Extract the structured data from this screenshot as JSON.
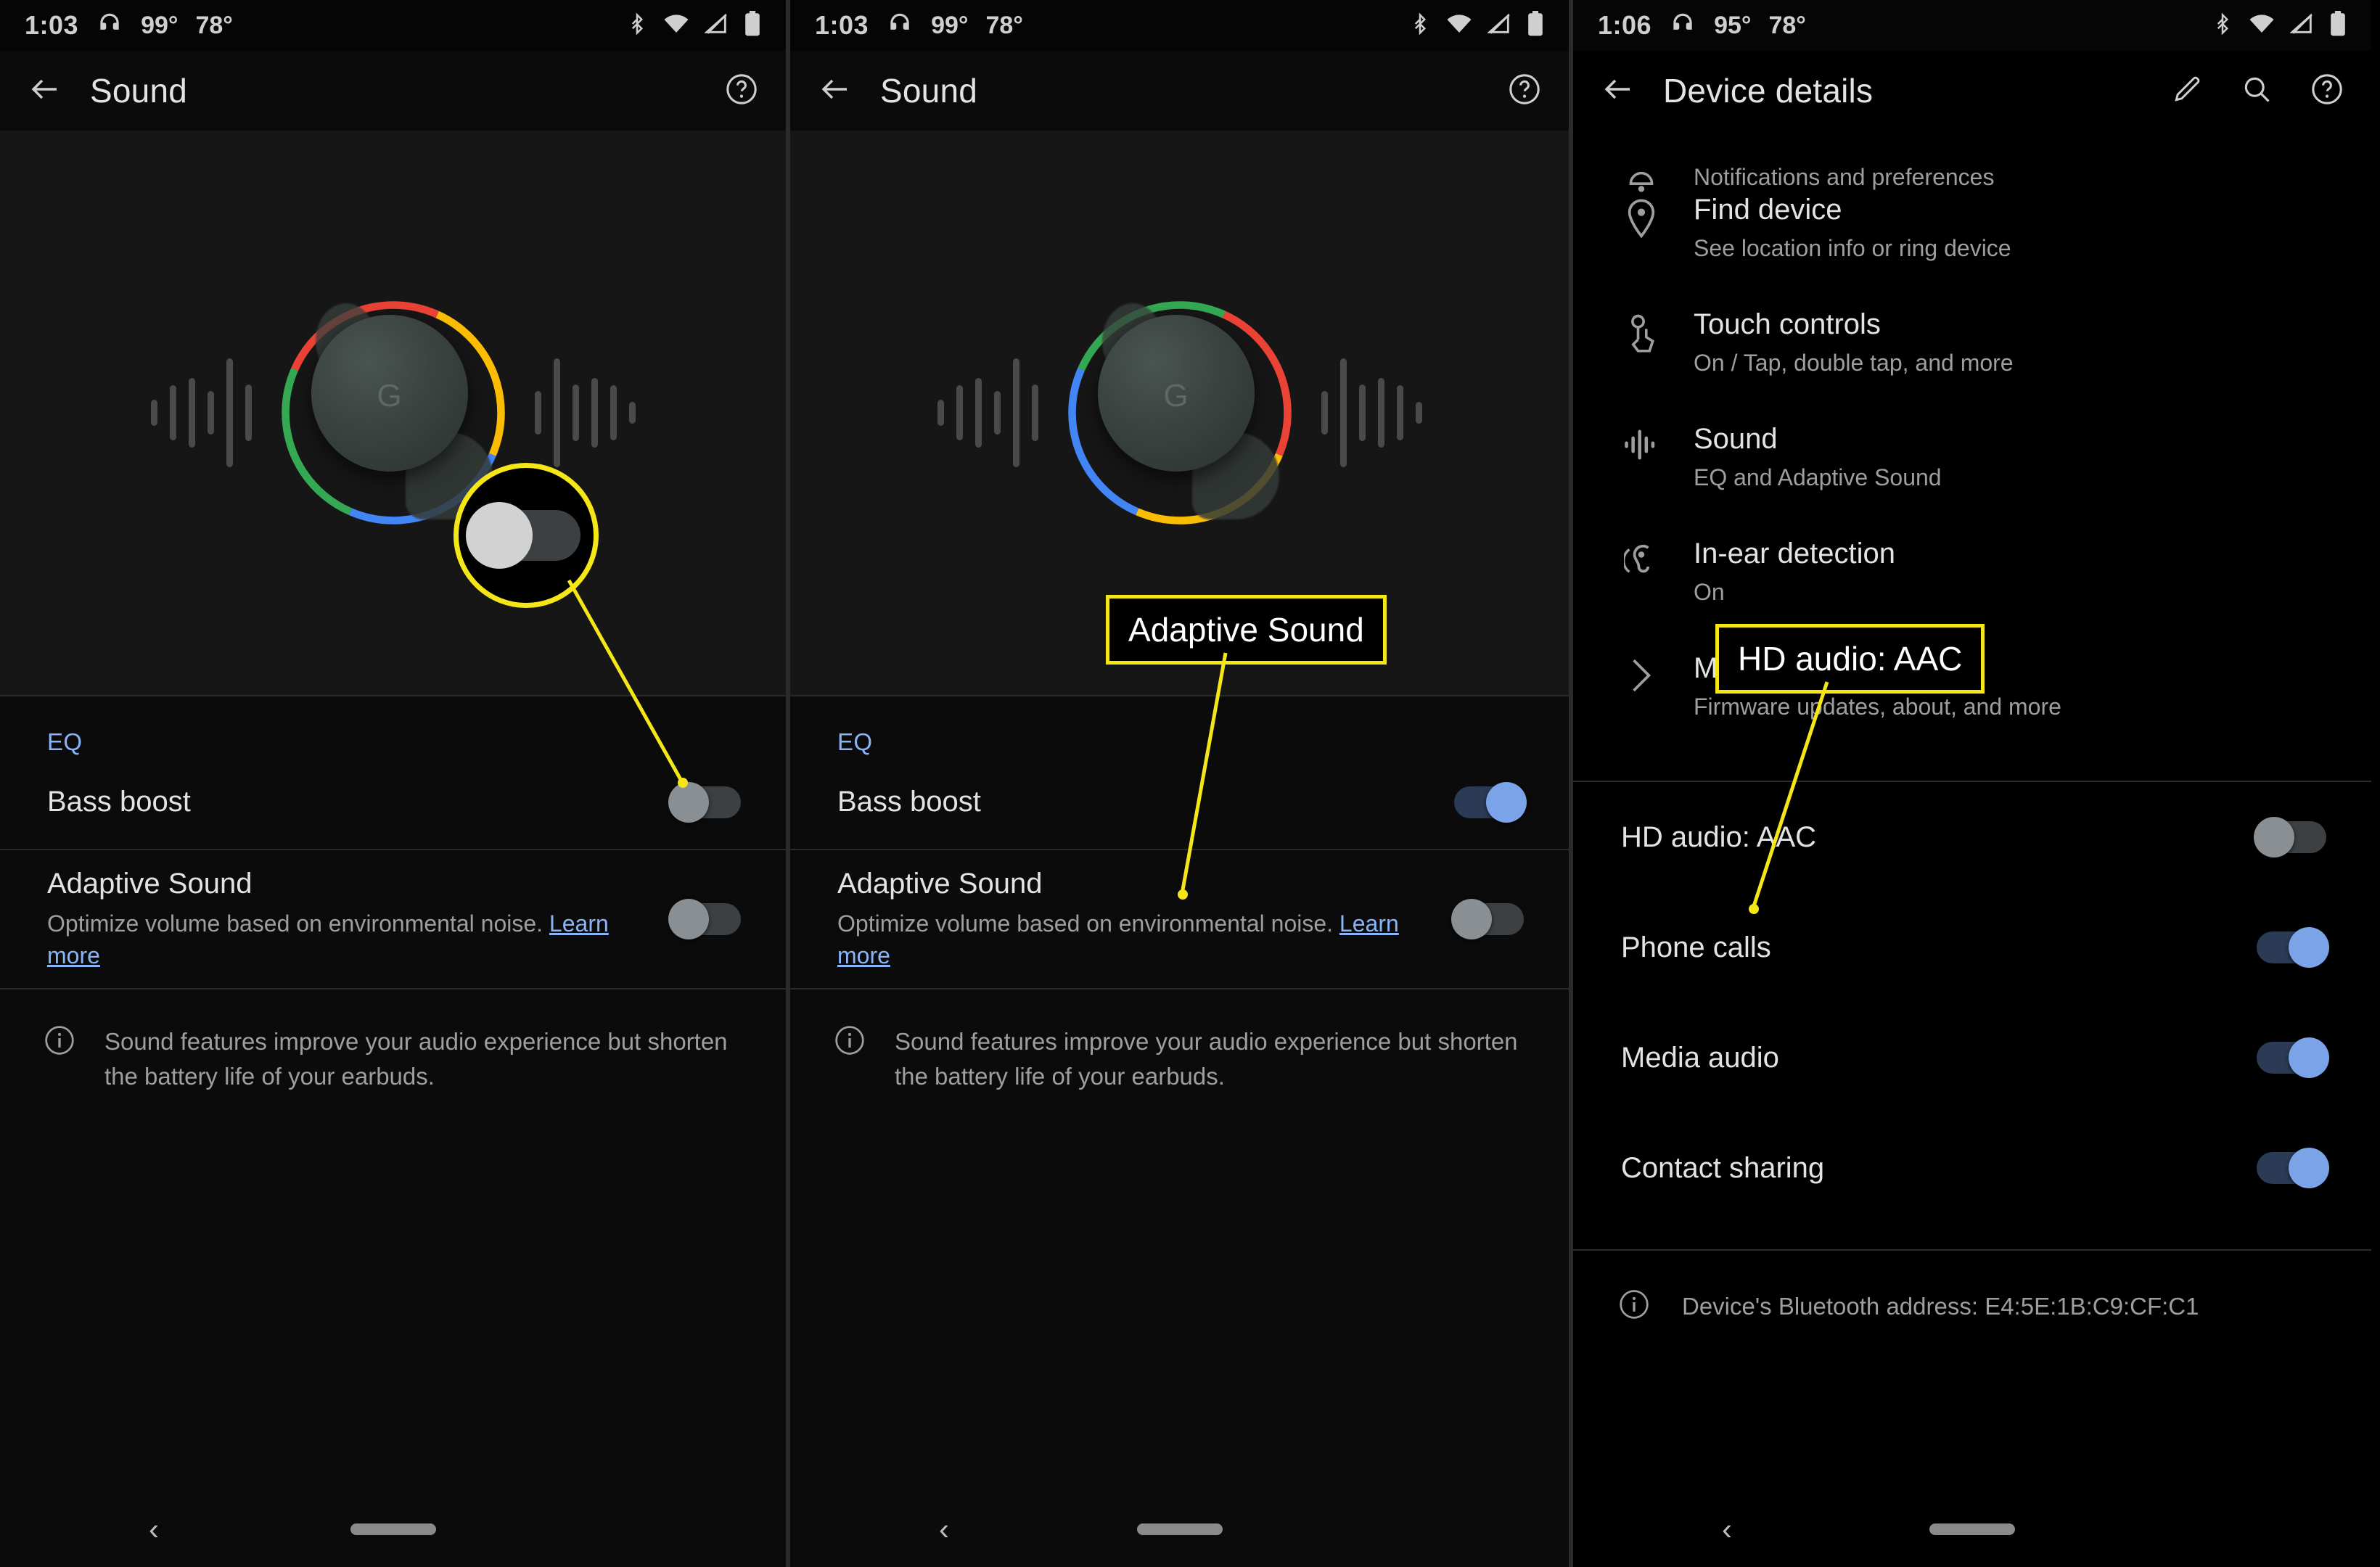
{
  "panels": [
    {
      "id": "sound-off",
      "status": {
        "time": "1:03",
        "headphone_icon": "headphone-icon",
        "temp1": "99°",
        "temp2": "78°",
        "icons": [
          "bluetooth-icon",
          "wifi-icon",
          "signal-off-icon",
          "battery-icon"
        ]
      },
      "appbar": {
        "back_icon": "back-arrow-icon",
        "title": "Sound",
        "help_icon": "help-circle-icon"
      },
      "eq_label": "EQ",
      "rows": [
        {
          "title": "Bass boost",
          "subtitle": "",
          "toggle": "off"
        },
        {
          "title": "Adaptive Sound",
          "subtitle": "Optimize volume based on environmental noise.",
          "link": "Learn more",
          "toggle": "off"
        }
      ],
      "note": {
        "icon": "info-circle-icon",
        "text": "Sound features improve your audio experience but shorten the battery life of your earbuds."
      },
      "nav": {
        "back": "nav-back-icon",
        "pill": "nav-home-pill"
      }
    },
    {
      "id": "sound-on",
      "status": {
        "time": "1:03",
        "headphone_icon": "headphone-icon",
        "temp1": "99°",
        "temp2": "78°",
        "icons": [
          "bluetooth-icon",
          "wifi-icon",
          "signal-off-icon",
          "battery-icon"
        ]
      },
      "appbar": {
        "back_icon": "back-arrow-icon",
        "title": "Sound",
        "help_icon": "help-circle-icon"
      },
      "eq_label": "EQ",
      "rows": [
        {
          "title": "Bass boost",
          "subtitle": "",
          "toggle": "on"
        },
        {
          "title": "Adaptive Sound",
          "subtitle": "Optimize volume based on environmental noise.",
          "link": "Learn more",
          "toggle": "off"
        }
      ],
      "note": {
        "icon": "info-circle-icon",
        "text": "Sound features improve your audio experience but shorten the battery life of your earbuds."
      },
      "nav": {
        "back": "nav-back-icon",
        "pill": "nav-home-pill"
      }
    },
    {
      "id": "device-details",
      "status": {
        "time": "1:06",
        "headphone_icon": "headphone-icon",
        "temp1": "95°",
        "temp2": "78°",
        "icons": [
          "bluetooth-icon",
          "wifi-icon",
          "signal-off-icon",
          "battery-icon"
        ]
      },
      "appbar": {
        "back_icon": "back-arrow-icon",
        "title": "Device details",
        "edit_icon": "pencil-icon",
        "search_icon": "search-icon",
        "help_icon": "help-circle-icon"
      },
      "settings": [
        {
          "icon": "bell-icon",
          "title": "",
          "subtitle": "Notifications and preferences",
          "clipped": true
        },
        {
          "icon": "location-pin-icon",
          "title": "Find device",
          "subtitle": "See location info or ring device"
        },
        {
          "icon": "touch-hand-icon",
          "title": "Touch controls",
          "subtitle": "On / Tap, double tap, and more"
        },
        {
          "icon": "sound-wave-icon",
          "title": "Sound",
          "subtitle": "EQ and Adaptive Sound"
        },
        {
          "icon": "in-ear-icon",
          "title": "In-ear detection",
          "subtitle": "On"
        },
        {
          "icon": "chevron-right-icon",
          "title": "More settings",
          "subtitle": "Firmware updates, about, and more"
        }
      ],
      "toggles": [
        {
          "label": "HD audio: AAC",
          "state": "off"
        },
        {
          "label": "Phone calls",
          "state": "on"
        },
        {
          "label": "Media audio",
          "state": "on"
        },
        {
          "label": "Contact sharing",
          "state": "on"
        }
      ],
      "bluetooth": {
        "icon": "info-circle-icon",
        "text": "Device's Bluetooth address: E4:5E:1B:C9:CF:C1"
      },
      "nav": {
        "back": "nav-back-icon",
        "pill": "nav-home-pill"
      }
    }
  ],
  "annotations": {
    "magnifier_label": "adaptive-sound-toggle-magnifier",
    "callout_adaptive_sound": "Adaptive Sound",
    "callout_hd_audio": "HD audio: AAC"
  },
  "colors": {
    "accent_blue": "#8ab4f8",
    "highlight_yellow": "#f5e617",
    "toggle_on": "#7ba3e8",
    "toggle_off": "#8a8f93",
    "text_primary": "#e3e3e3",
    "text_secondary": "#9e9e9e"
  }
}
